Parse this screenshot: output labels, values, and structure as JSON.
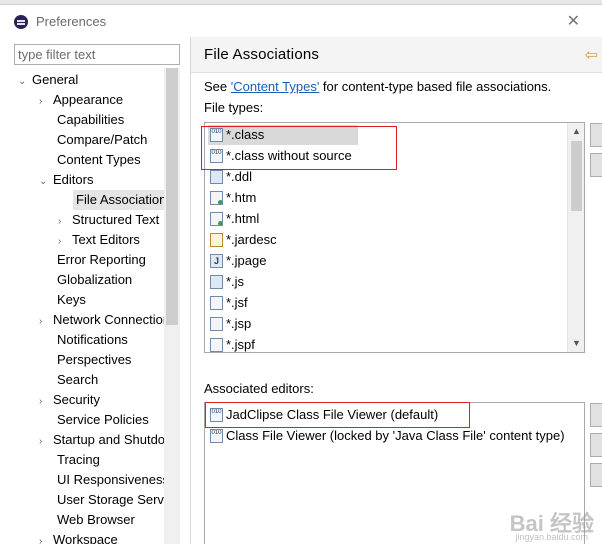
{
  "window": {
    "title": "Preferences",
    "close_glyph": "✕"
  },
  "filter": {
    "placeholder": "type filter text"
  },
  "tree": {
    "items": [
      {
        "label": "General",
        "arrow": "⌄"
      },
      {
        "label": "Appearance",
        "arrow": "›"
      },
      {
        "label": "Capabilities",
        "arrow": ""
      },
      {
        "label": "Compare/Patch",
        "arrow": ""
      },
      {
        "label": "Content Types",
        "arrow": ""
      },
      {
        "label": "Editors",
        "arrow": "⌄"
      },
      {
        "label": "File Associations",
        "arrow": ""
      },
      {
        "label": "Structured Text",
        "arrow": "›"
      },
      {
        "label": "Text Editors",
        "arrow": "›"
      },
      {
        "label": "Error Reporting",
        "arrow": ""
      },
      {
        "label": "Globalization",
        "arrow": ""
      },
      {
        "label": "Keys",
        "arrow": ""
      },
      {
        "label": "Network Connections",
        "arrow": "›"
      },
      {
        "label": "Notifications",
        "arrow": ""
      },
      {
        "label": "Perspectives",
        "arrow": ""
      },
      {
        "label": "Search",
        "arrow": ""
      },
      {
        "label": "Security",
        "arrow": "›"
      },
      {
        "label": "Service Policies",
        "arrow": ""
      },
      {
        "label": "Startup and Shutdown",
        "arrow": "›"
      },
      {
        "label": "Tracing",
        "arrow": ""
      },
      {
        "label": "UI Responsiveness",
        "arrow": ""
      },
      {
        "label": "User Storage Service",
        "arrow": ""
      },
      {
        "label": "Web Browser",
        "arrow": ""
      },
      {
        "label": "Workspace",
        "arrow": "›"
      }
    ]
  },
  "page": {
    "title": "File Associations",
    "back_glyph": "⇦",
    "see_prefix": "See ",
    "see_link": "'Content Types'",
    "see_suffix": " for content-type based file associations.",
    "file_types_label": "File types:",
    "associated_label": "Associated editors:"
  },
  "file_types": [
    {
      "label": "*.class",
      "icon": "class-file-icon",
      "glyph": "010"
    },
    {
      "label": "*.class without source",
      "icon": "class-file-icon",
      "glyph": "010"
    },
    {
      "label": "*.ddl",
      "icon": "ddl-file-icon",
      "glyph": ""
    },
    {
      "label": "*.htm",
      "icon": "html-file-icon",
      "glyph": ""
    },
    {
      "label": "*.html",
      "icon": "html-file-icon",
      "glyph": ""
    },
    {
      "label": "*.jardesc",
      "icon": "jardesc-file-icon",
      "glyph": ""
    },
    {
      "label": "*.jpage",
      "icon": "jpage-file-icon",
      "glyph": "J"
    },
    {
      "label": "*.js",
      "icon": "js-file-icon",
      "glyph": ""
    },
    {
      "label": "*.jsf",
      "icon": "jsf-file-icon",
      "glyph": ""
    },
    {
      "label": "*.jsp",
      "icon": "jsp-file-icon",
      "glyph": ""
    },
    {
      "label": "*.jspf",
      "icon": "jspf-file-icon",
      "glyph": ""
    }
  ],
  "editors": [
    {
      "label": "JadClipse Class File Viewer (default)",
      "icon": "class-viewer-icon",
      "glyph": "010"
    },
    {
      "label": "Class File Viewer (locked by 'Java Class File' content type)",
      "icon": "class-viewer-icon",
      "glyph": "010"
    }
  ],
  "scroll": {
    "up_glyph": "▲",
    "down_glyph": "▼"
  },
  "watermark": {
    "text": "Bai 经验",
    "sub": "jingyan.baidu.com"
  },
  "colors": {
    "link": "#1a5fb4",
    "highlight_box": "#e02020",
    "selection": "#d9d9d9"
  }
}
